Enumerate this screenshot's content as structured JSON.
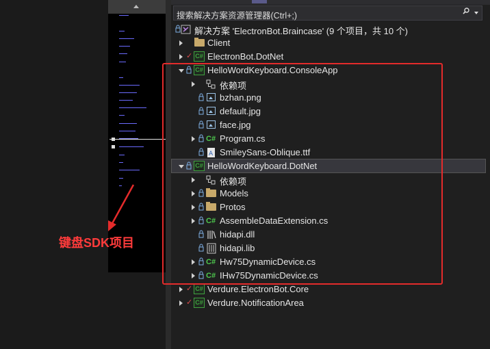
{
  "search": {
    "placeholder": "搜索解决方案资源管理器(Ctrl+;)"
  },
  "annotation": {
    "label": "键盘SDK项目",
    "color": "#e42b2b"
  },
  "solution": {
    "label": "解决方案 'ElectronBot.Braincase' (9 个项目，共 10 个)"
  },
  "tree": [
    {
      "label": "Client",
      "icon": "folder-icon"
    },
    {
      "label": "ElectronBot.DotNet",
      "icon": "csharp-project-icon"
    },
    {
      "label": "HelloWordKeyboard.ConsoleApp",
      "icon": "csharp-project-icon"
    },
    {
      "label": "依赖项",
      "icon": "dependencies-icon"
    },
    {
      "label": "bzhan.png",
      "icon": "image-file-icon"
    },
    {
      "label": "default.jpg",
      "icon": "image-file-icon"
    },
    {
      "label": "face.jpg",
      "icon": "image-file-icon"
    },
    {
      "label": "Program.cs",
      "icon": "csharp-file-icon"
    },
    {
      "label": "SmileySans-Oblique.ttf",
      "icon": "font-file-icon"
    },
    {
      "label": "HelloWordKeyboard.DotNet",
      "icon": "csharp-project-icon"
    },
    {
      "label": "依赖项",
      "icon": "dependencies-icon"
    },
    {
      "label": "Models",
      "icon": "folder-icon"
    },
    {
      "label": "Protos",
      "icon": "folder-icon"
    },
    {
      "label": "AssembleDataExtension.cs",
      "icon": "csharp-file-icon"
    },
    {
      "label": "hidapi.dll",
      "icon": "dll-file-icon"
    },
    {
      "label": "hidapi.lib",
      "icon": "lib-file-icon"
    },
    {
      "label": "Hw75DynamicDevice.cs",
      "icon": "csharp-file-icon"
    },
    {
      "label": "IHw75DynamicDevice.cs",
      "icon": "csharp-file-icon"
    },
    {
      "label": "Verdure.ElectronBot.Core",
      "icon": "csharp-project-icon"
    },
    {
      "label": "Verdure.NotificationArea",
      "icon": "csharp-project-icon"
    }
  ]
}
